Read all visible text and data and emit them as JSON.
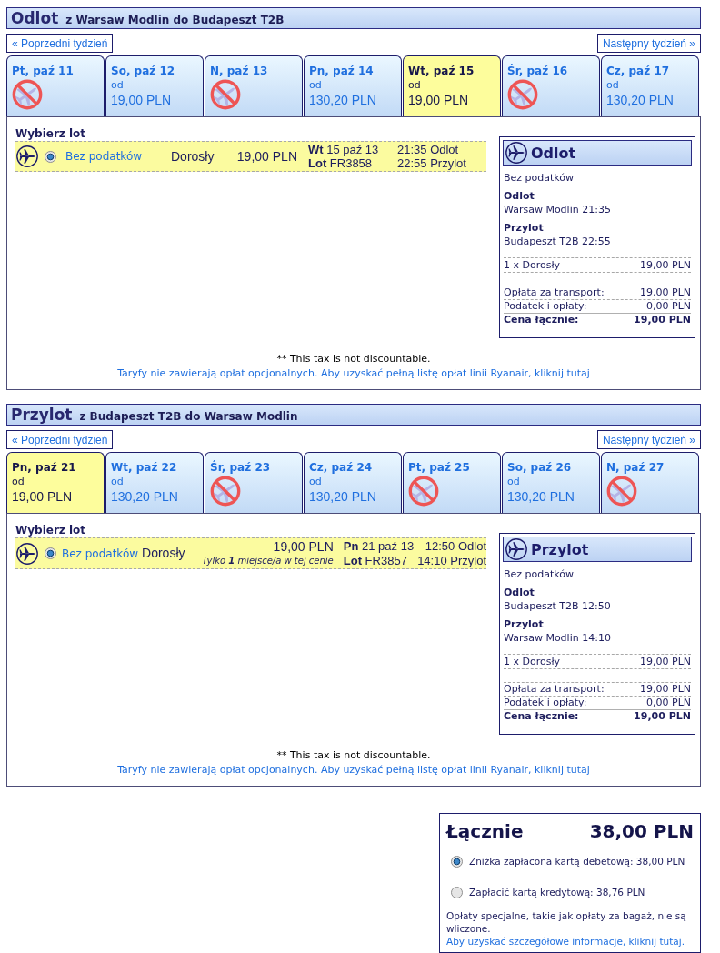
{
  "sections": [
    {
      "title": "Odlot",
      "route": "z Warsaw Modlin do Budapeszt T2B",
      "prev_week": "« Poprzedni tydzień",
      "next_week": "Następny tydzień »",
      "days": [
        {
          "label": "Pt, paź 11",
          "selected": false,
          "available": false
        },
        {
          "label": "So, paź 12",
          "selected": false,
          "available": true,
          "from": "od",
          "price": "19,00 PLN"
        },
        {
          "label": "N, paź 13",
          "selected": false,
          "available": false
        },
        {
          "label": "Pn, paź 14",
          "selected": false,
          "available": true,
          "from": "od",
          "price": "130,20 PLN"
        },
        {
          "label": "Wt, paź 15",
          "selected": true,
          "available": true,
          "from": "od",
          "price": "19,00 PLN"
        },
        {
          "label": "Śr, paź 16",
          "selected": false,
          "available": false
        },
        {
          "label": "Cz, paź 17",
          "selected": false,
          "available": true,
          "from": "od",
          "price": "130,20 PLN"
        }
      ],
      "choose_label": "Wybierz lot",
      "flights": [
        {
          "kind": "standard",
          "selected": true,
          "fare": "Bez podatków",
          "passenger": "Dorosły",
          "price": "19,00 PLN",
          "date": "**Wt** 15 paź 13",
          "flight": "**Lot** FR3858",
          "departure": "21:35 Odlot",
          "arrival": "22:55 Przylot"
        }
      ],
      "summary": {
        "title": "Odlot",
        "fare": "Bez podatków",
        "legs": [
          {
            "label": "Odlot",
            "value": "Warsaw Modlin 21:35"
          },
          {
            "label": "Przylot",
            "value": "Budapeszt T2B 22:55"
          }
        ],
        "passengers": [
          {
            "label": "1 x Dorosły",
            "value": "19,00 PLN"
          }
        ],
        "charges": [
          {
            "label": "Opłata za transport:",
            "value": "19,00 PLN"
          },
          {
            "label": "Podatek i opłaty:",
            "value": "0,00 PLN"
          }
        ],
        "total": {
          "label": "Cena łącznie:",
          "value": "19,00 PLN"
        }
      },
      "tax_note": "** This tax is not discountable.",
      "fees_link": "Taryfy nie zawierają opłat opcjonalnych. Aby uzyskać pełną listę opłat linii Ryanair, kliknij tutaj"
    },
    {
      "title": "Przylot",
      "route": "z Budapeszt T2B do Warsaw Modlin",
      "prev_week": "« Poprzedni tydzień",
      "next_week": "Następny tydzień »",
      "days": [
        {
          "label": "Pn, paź 21",
          "selected": true,
          "available": true,
          "from": "od",
          "price": "19,00 PLN"
        },
        {
          "label": "Wt, paź 22",
          "selected": false,
          "available": true,
          "from": "od",
          "price": "130,20 PLN"
        },
        {
          "label": "Śr, paź 23",
          "selected": false,
          "available": false
        },
        {
          "label": "Cz, paź 24",
          "selected": false,
          "available": true,
          "from": "od",
          "price": "130,20 PLN"
        },
        {
          "label": "Pt, paź 25",
          "selected": false,
          "available": false
        },
        {
          "label": "So, paź 26",
          "selected": false,
          "available": true,
          "from": "od",
          "price": "130,20 PLN"
        },
        {
          "label": "N, paź 27",
          "selected": false,
          "available": false
        }
      ],
      "choose_label": "Wybierz lot",
      "flights": [
        {
          "kind": "limited",
          "selected": true,
          "fare": "Bez podatków",
          "passenger": "Dorosły",
          "price": "19,00 PLN",
          "note": "Tylko **1** miejsce/a w tej cenie",
          "date": "**Pn** 21 paź 13",
          "flight": "**Lot** FR3857",
          "departure": "12:50 Odlot",
          "arrival": "14:10 Przylot"
        }
      ],
      "summary": {
        "title": "Przylot",
        "fare": "Bez podatków",
        "legs": [
          {
            "label": "Odlot",
            "value": "Budapeszt T2B 12:50"
          },
          {
            "label": "Przylot",
            "value": "Warsaw Modlin 14:10"
          }
        ],
        "passengers": [
          {
            "label": "1 x Dorosły",
            "value": "19,00 PLN"
          }
        ],
        "charges": [
          {
            "label": "Opłata za transport:",
            "value": "19,00 PLN"
          },
          {
            "label": "Podatek i opłaty:",
            "value": "0,00 PLN"
          }
        ],
        "total": {
          "label": "Cena łącznie:",
          "value": "19,00 PLN"
        }
      },
      "tax_note": "** This tax is not discountable.",
      "fees_link": "Taryfy nie zawierają opłat opcjonalnych. Aby uzyskać pełną listę opłat linii Ryanair, kliknij tutaj"
    }
  ],
  "total": {
    "title": "Łącznie",
    "amount": "38,00 PLN",
    "payment_options": [
      {
        "label": "Zniżka zapłacona kartą debetową: 38,00 PLN",
        "selected": true
      },
      {
        "label": "Zapłacić kartą kredytową: 38,76 PLN",
        "selected": false
      }
    ],
    "notice": "Opłaty specjalne, takie jak opłaty za bagaż, nie są wliczone.",
    "notice_link": "Aby uzyskać szczegółowe informacje, kliknij tutaj."
  }
}
